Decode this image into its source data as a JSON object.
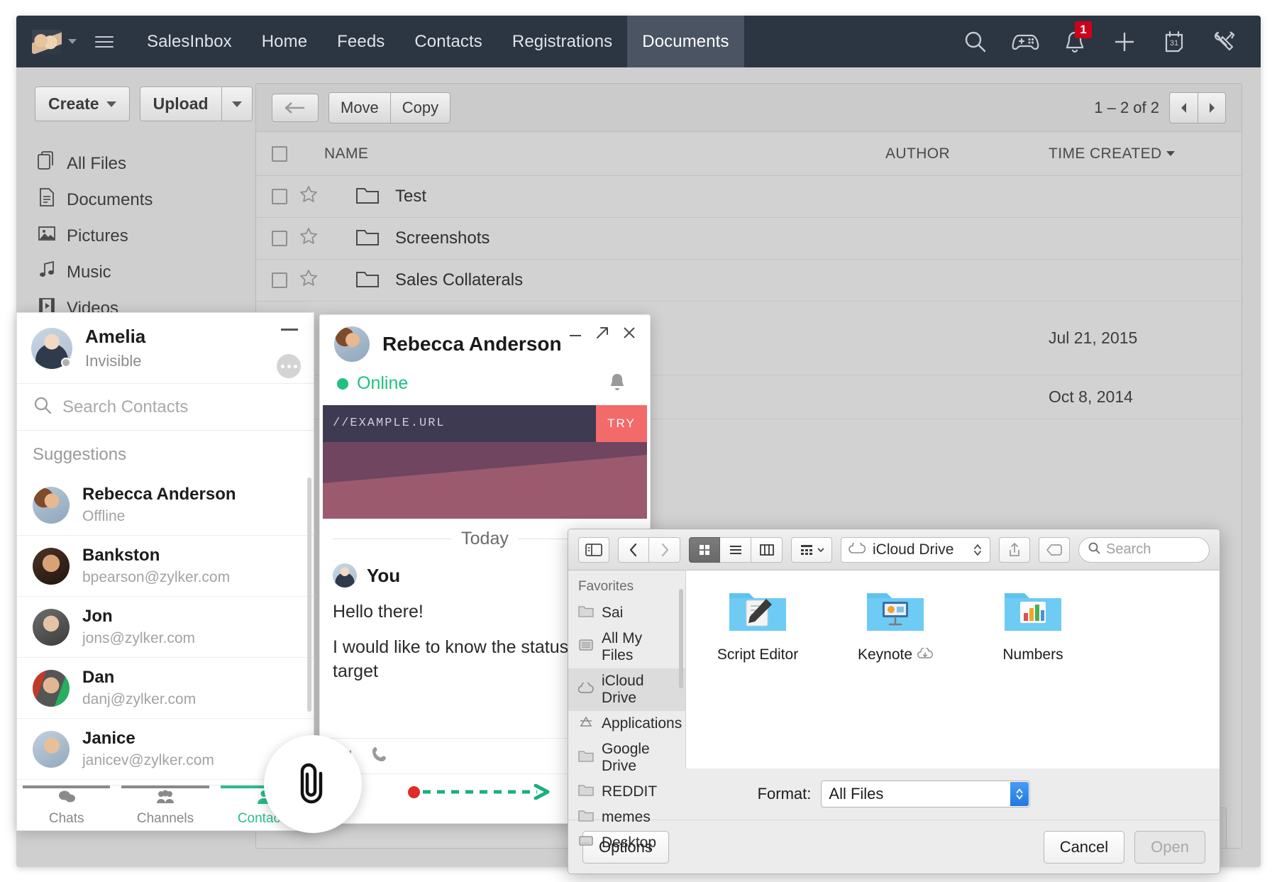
{
  "topnav": {
    "caret_icon": "chevron-down-icon",
    "menu_icon": "hamburger-menu-icon",
    "links": [
      {
        "label": "SalesInbox",
        "active": false
      },
      {
        "label": "Home",
        "active": false
      },
      {
        "label": "Feeds",
        "active": false
      },
      {
        "label": "Contacts",
        "active": false
      },
      {
        "label": "Registrations",
        "active": false
      },
      {
        "label": "Documents",
        "active": true
      }
    ],
    "icons": [
      {
        "name": "search-icon"
      },
      {
        "name": "game-controller-icon"
      },
      {
        "name": "bell-icon"
      },
      {
        "name": "plus-icon"
      },
      {
        "name": "calendar-icon"
      },
      {
        "name": "tools-icon"
      }
    ],
    "notification_count": "1",
    "calendar_day": "31"
  },
  "docs_sidebar": {
    "create_label": "Create",
    "upload_label": "Upload",
    "items": [
      {
        "label": "All Files",
        "icon": "copy-files-icon"
      },
      {
        "label": "Documents",
        "icon": "document-icon"
      },
      {
        "label": "Pictures",
        "icon": "picture-icon"
      },
      {
        "label": "Music",
        "icon": "music-note-icon"
      },
      {
        "label": "Videos",
        "icon": "film-strip-icon"
      }
    ]
  },
  "files": {
    "toolbar": {
      "back_icon": "arrow-left-icon",
      "move_label": "Move",
      "copy_label": "Copy",
      "pager_label": "1 – 2 of 2",
      "prev_icon": "triangle-left-icon",
      "next_icon": "triangle-right-icon"
    },
    "columns": {
      "name": "NAME",
      "author": "AUTHOR",
      "time": "TIME CREATED"
    },
    "rows": [
      {
        "name": "Test",
        "date": ""
      },
      {
        "name": "Screenshots",
        "date": ""
      },
      {
        "name": "Sales Collaterals",
        "date": ""
      },
      {
        "name": "",
        "date": "Jul 21, 2015"
      },
      {
        "name": "",
        "date": "Oct 8, 2014"
      }
    ],
    "corner_icons": [
      {
        "name": "alarm-clock-icon"
      },
      {
        "name": "clock-icon"
      }
    ]
  },
  "chat_panel": {
    "user": {
      "name": "Amelia",
      "status": "Invisible"
    },
    "minimize_icon": "minimize-icon",
    "more_icon": "more-options-icon",
    "search_placeholder": "Search Contacts",
    "search_icon": "search-icon",
    "suggestions_label": "Suggestions",
    "contacts": [
      {
        "name": "Rebecca Anderson",
        "sub": "Offline",
        "avatar": "av-rebecca"
      },
      {
        "name": "Bankston",
        "sub": "bpearson@zylker.com",
        "avatar": "av-bank"
      },
      {
        "name": "Jon",
        "sub": "jons@zylker.com",
        "avatar": "av-jon"
      },
      {
        "name": "Dan",
        "sub": "danj@zylker.com",
        "avatar": "av-dan"
      },
      {
        "name": "Janice",
        "sub": "janicev@zylker.com",
        "avatar": "av-janice"
      }
    ],
    "tabs": [
      {
        "label": "Chats",
        "icon": "chat-bubbles-icon",
        "active": false
      },
      {
        "label": "Channels",
        "icon": "group-people-icon",
        "active": false
      },
      {
        "label": "Contacts",
        "icon": "person-icon",
        "active": true
      }
    ],
    "accent_color": "#2bbd8a"
  },
  "chat_window": {
    "title": "Rebecca Anderson",
    "status": "Online",
    "status_color": "#22c07f",
    "controls": [
      {
        "name": "minimize-icon"
      },
      {
        "name": "popout-icon"
      },
      {
        "name": "close-icon"
      }
    ],
    "bell_icon": "bell-icon",
    "banner": {
      "url": "//EXAMPLE.URL",
      "cta": "TRY"
    },
    "day_divider": "Today",
    "message": {
      "author": "You",
      "lines": [
        "Hello there!",
        "I would like to know the status sales target"
      ]
    },
    "action_icons": [
      {
        "name": "video-camera-icon"
      },
      {
        "name": "phone-icon"
      }
    ],
    "attachment_icon": "paperclip-icon",
    "drag_arrow_icon": "dashed-arrow-right-icon"
  },
  "finder": {
    "toolbar": {
      "sidebar_toggle_icon": "sidebar-toggle-icon",
      "back_icon": "chevron-left-icon",
      "forward_icon": "chevron-right-icon",
      "view_icons": [
        {
          "name": "icon-view-icon",
          "selected": true
        },
        {
          "name": "list-view-icon",
          "selected": false
        },
        {
          "name": "column-view-icon",
          "selected": false
        }
      ],
      "arrange_icon": "arrange-grid-icon",
      "path_label": "iCloud Drive",
      "path_icon": "cloud-icon",
      "share_icon": "share-icon",
      "tag_icon": "tag-icon",
      "search_placeholder": "Search",
      "search_icon": "search-icon"
    },
    "sidebar": {
      "title": "Favorites",
      "items": [
        {
          "label": "Sai",
          "icon": "folder-icon",
          "selected": false
        },
        {
          "label": "All My Files",
          "icon": "all-my-files-icon",
          "selected": false
        },
        {
          "label": "iCloud Drive",
          "icon": "cloud-icon",
          "selected": true
        },
        {
          "label": "Applications",
          "icon": "applications-icon",
          "selected": false
        },
        {
          "label": "Google Drive",
          "icon": "folder-icon",
          "selected": false
        },
        {
          "label": "REDDIT",
          "icon": "folder-icon",
          "selected": false
        },
        {
          "label": "memes",
          "icon": "folder-icon",
          "selected": false
        },
        {
          "label": "Desktop",
          "icon": "desktop-folder-icon",
          "selected": false
        }
      ]
    },
    "items": [
      {
        "label": "Script Editor",
        "icon": "script-editor-folder-icon",
        "cloud": false
      },
      {
        "label": "Keynote",
        "icon": "keynote-folder-icon",
        "cloud": true
      },
      {
        "label": "Numbers",
        "icon": "numbers-folder-icon",
        "cloud": false
      }
    ],
    "format": {
      "label": "Format:",
      "value": "All Files"
    },
    "footer": {
      "options_label": "Options",
      "cancel_label": "Cancel",
      "open_label": "Open"
    }
  }
}
